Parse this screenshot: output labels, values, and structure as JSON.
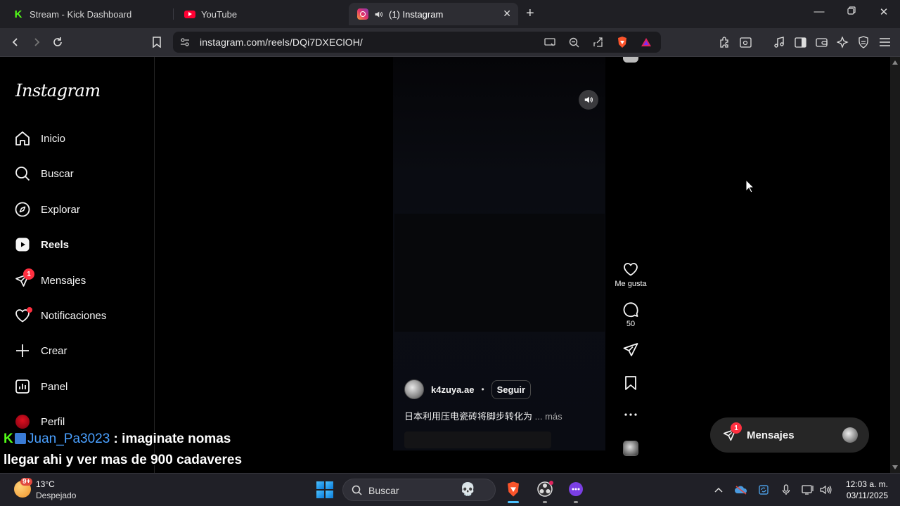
{
  "browser": {
    "tabs": [
      {
        "title": "Stream - Kick Dashboard",
        "favicon": "kick-logo-icon",
        "active": false
      },
      {
        "title": "YouTube",
        "favicon": "youtube-logo-icon",
        "active": false
      },
      {
        "title": "(1) Instagram",
        "favicon": "instagram-logo-icon",
        "active": true,
        "audio": true
      }
    ],
    "url": "instagram.com/reels/DQi7DXEClOH/"
  },
  "instagram": {
    "logo": "Instagram",
    "nav": [
      {
        "label": "Inicio",
        "icon": "home-icon"
      },
      {
        "label": "Buscar",
        "icon": "search-icon"
      },
      {
        "label": "Explorar",
        "icon": "compass-icon"
      },
      {
        "label": "Reels",
        "icon": "reels-icon",
        "active": true
      },
      {
        "label": "Mensajes",
        "icon": "messenger-icon",
        "badge": "1"
      },
      {
        "label": "Notificaciones",
        "icon": "heart-icon",
        "dot": true
      },
      {
        "label": "Crear",
        "icon": "plus-icon"
      },
      {
        "label": "Panel",
        "icon": "dashboard-icon"
      },
      {
        "label": "Perfil",
        "icon": "profile-avatar"
      }
    ],
    "reel": {
      "actions": {
        "like_label": "Me gusta",
        "comment_count": "50"
      },
      "author": "k4zuya.ae",
      "bullet": "•",
      "follow_label": "Seguir",
      "caption": "日本利用压电瓷砖将脚步转化为",
      "caption_more": "... más"
    },
    "messages_pill": {
      "label": "Mensajes",
      "badge": "1"
    }
  },
  "chat_overlay": {
    "username": "Juan_Pa3023",
    "line1": " : imaginate nomas",
    "line2": "llegar ahi y ver mas de 900 cadaveres"
  },
  "taskbar": {
    "weather_badge": "9+",
    "temperature": "13°C",
    "weather": "Despejado",
    "search_placeholder": "Buscar",
    "time": "12:03 a. m.",
    "date": "03/11/2025"
  },
  "colors": {
    "accent_red": "#ff3040",
    "kick_green": "#53fc18",
    "chat_username": "#4aa0ff"
  }
}
